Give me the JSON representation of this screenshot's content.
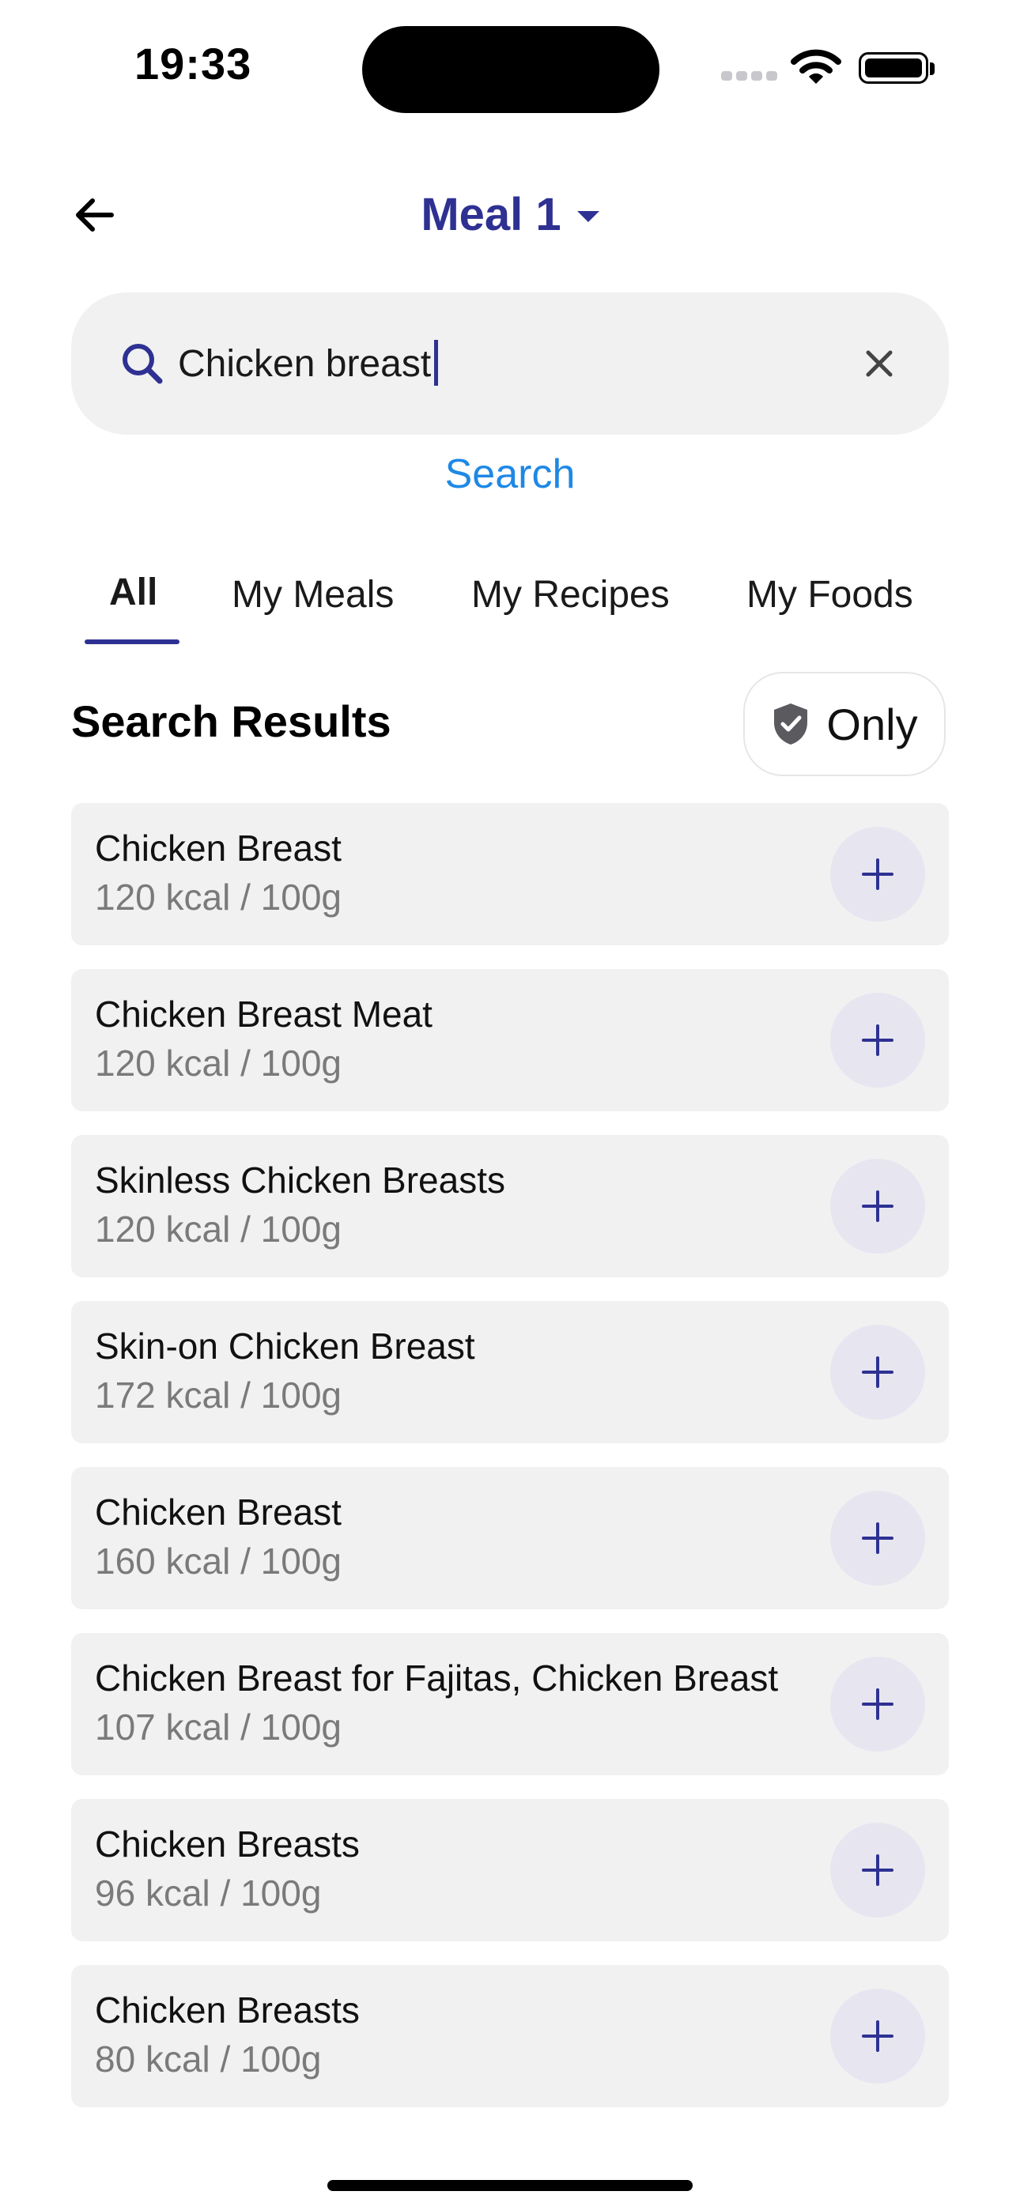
{
  "status_bar": {
    "time": "19:33"
  },
  "header": {
    "title": "Meal 1"
  },
  "search": {
    "value": "Chicken breast",
    "button_label": "Search"
  },
  "tabs": [
    {
      "label": "All",
      "active": true
    },
    {
      "label": "My Meals",
      "active": false
    },
    {
      "label": "My Recipes",
      "active": false
    },
    {
      "label": "My Foods",
      "active": false
    }
  ],
  "results": {
    "title": "Search Results",
    "filter_label": "Only",
    "items": [
      {
        "name": "Chicken Breast",
        "kcal": "120 kcal / 100g"
      },
      {
        "name": "Chicken Breast Meat",
        "kcal": "120 kcal / 100g"
      },
      {
        "name": "Skinless Chicken Breasts",
        "kcal": "120 kcal / 100g"
      },
      {
        "name": "Skin-on Chicken Breast",
        "kcal": "172 kcal / 100g"
      },
      {
        "name": "Chicken Breast",
        "kcal": "160 kcal / 100g"
      },
      {
        "name": "Chicken Breast for Fajitas, Chicken Breast",
        "kcal": "107 kcal / 100g"
      },
      {
        "name": "Chicken Breasts",
        "kcal": "96 kcal / 100g"
      },
      {
        "name": "Chicken Breasts",
        "kcal": "80 kcal / 100g"
      }
    ]
  },
  "colors": {
    "accent": "#2e3192",
    "link": "#1e88e5",
    "card_background": "#f1f1f2",
    "secondary_text": "#7a7a7a"
  }
}
